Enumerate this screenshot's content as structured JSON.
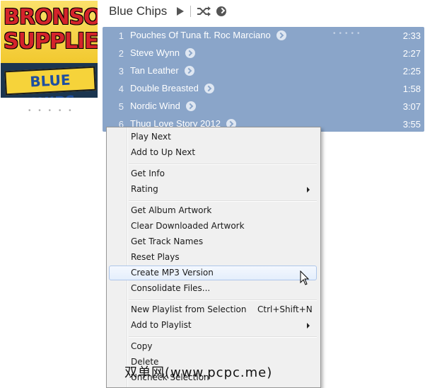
{
  "album": {
    "title": "Blue Chips",
    "art_text_line1": "BRONSON",
    "art_text_line2": "SUPPLIES",
    "art_banner": "BLUE CHIPS"
  },
  "controls": {
    "play_icon": "play-icon",
    "shuffle_icon": "shuffle-icon",
    "more_icon": "chevron-right-circle-icon"
  },
  "tracks": [
    {
      "num": "1",
      "name": "Pouches Of Tuna ft. Roc Marciano",
      "duration": "2:33"
    },
    {
      "num": "2",
      "name": "Steve Wynn",
      "duration": "2:27"
    },
    {
      "num": "3",
      "name": "Tan Leather",
      "duration": "2:25"
    },
    {
      "num": "4",
      "name": "Double Breasted",
      "duration": "1:58"
    },
    {
      "num": "5",
      "name": "Nordic Wind",
      "duration": "3:07"
    },
    {
      "num": "6",
      "name": "Thug Love Story 2012",
      "duration": "3:55"
    }
  ],
  "menu": {
    "items": [
      {
        "label": "Play Next"
      },
      {
        "label": "Add to Up Next"
      },
      {
        "label": "Get Info"
      },
      {
        "label": "Rating"
      },
      {
        "label": "Get Album Artwork"
      },
      {
        "label": "Clear Downloaded Artwork"
      },
      {
        "label": "Get Track Names"
      },
      {
        "label": "Reset Plays"
      },
      {
        "label": "Create MP3 Version"
      },
      {
        "label": "Consolidate Files..."
      },
      {
        "label": "New Playlist from Selection",
        "shortcut": "Ctrl+Shift+N"
      },
      {
        "label": "Add to Playlist"
      },
      {
        "label": "Copy"
      },
      {
        "label": "Delete"
      },
      {
        "label": "Uncheck Selection"
      }
    ]
  },
  "watermark": "双单网(www.pcpc.me)",
  "colors": {
    "selection": "#8aa5c9",
    "menu_bg": "#f0f0f0",
    "highlight_border": "#aec6ea"
  }
}
